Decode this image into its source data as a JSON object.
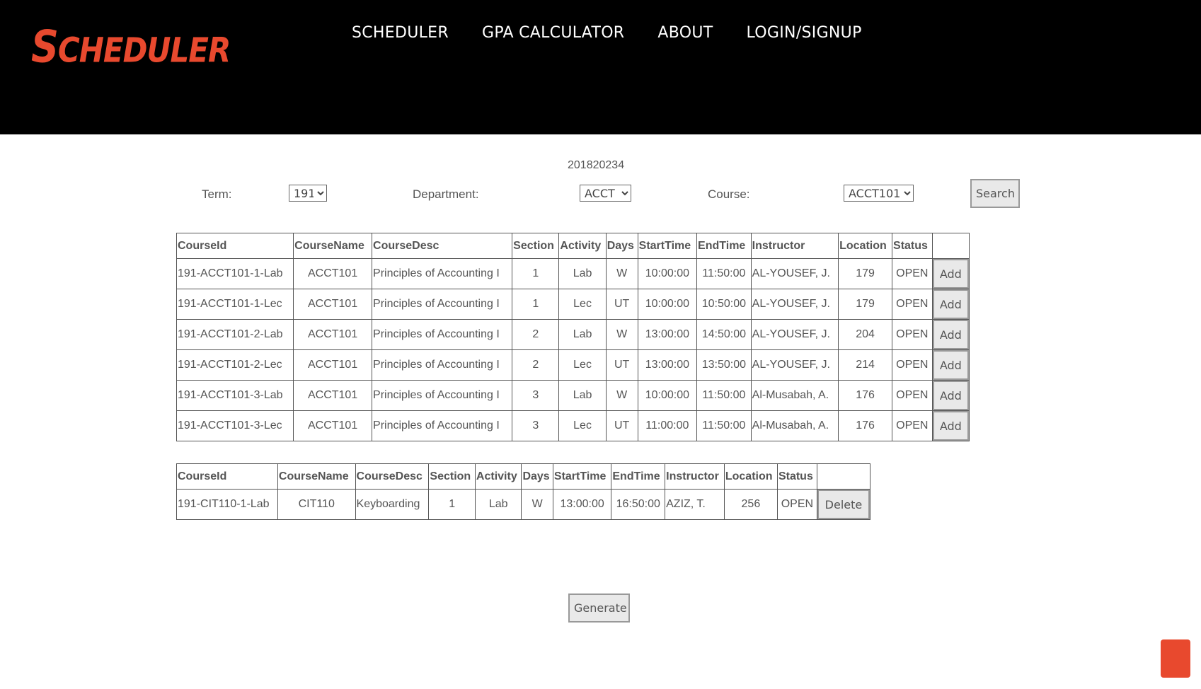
{
  "brand": {
    "logo_text": "Scheduler"
  },
  "nav": {
    "items": [
      {
        "label": "SCHEDULER"
      },
      {
        "label": "GPA CALCULATOR"
      },
      {
        "label": "ABOUT"
      },
      {
        "label": "LOGIN/SIGNUP"
      }
    ]
  },
  "student_id": "201820234",
  "filters": {
    "term_label": "Term:",
    "term_value": "191",
    "department_label": "Department:",
    "department_value": "ACCT",
    "course_label": "Course:",
    "course_value": "ACCT101",
    "search_label": "Search"
  },
  "columns": [
    "CourseId",
    "CourseName",
    "CourseDesc",
    "Section",
    "Activity",
    "Days",
    "StartTime",
    "EndTime",
    "Instructor",
    "Location",
    "Status"
  ],
  "available": [
    {
      "id": "191-ACCT101-1-Lab",
      "name": "ACCT101",
      "desc": "Principles of Accounting I",
      "section": "1",
      "activity": "Lab",
      "days": "W",
      "start": "10:00:00",
      "end": "11:50:00",
      "instructor": "AL-YOUSEF, J.",
      "location": "179",
      "status": "OPEN",
      "action": "Add"
    },
    {
      "id": "191-ACCT101-1-Lec",
      "name": "ACCT101",
      "desc": "Principles of Accounting I",
      "section": "1",
      "activity": "Lec",
      "days": "UT",
      "start": "10:00:00",
      "end": "10:50:00",
      "instructor": "AL-YOUSEF, J.",
      "location": "179",
      "status": "OPEN",
      "action": "Add"
    },
    {
      "id": "191-ACCT101-2-Lab",
      "name": "ACCT101",
      "desc": "Principles of Accounting I",
      "section": "2",
      "activity": "Lab",
      "days": "W",
      "start": "13:00:00",
      "end": "14:50:00",
      "instructor": "AL-YOUSEF, J.",
      "location": "204",
      "status": "OPEN",
      "action": "Add"
    },
    {
      "id": "191-ACCT101-2-Lec",
      "name": "ACCT101",
      "desc": "Principles of Accounting I",
      "section": "2",
      "activity": "Lec",
      "days": "UT",
      "start": "13:00:00",
      "end": "13:50:00",
      "instructor": "AL-YOUSEF, J.",
      "location": "214",
      "status": "OPEN",
      "action": "Add"
    },
    {
      "id": "191-ACCT101-3-Lab",
      "name": "ACCT101",
      "desc": "Principles of Accounting I",
      "section": "3",
      "activity": "Lab",
      "days": "W",
      "start": "10:00:00",
      "end": "11:50:00",
      "instructor": "Al-Musabah, A.",
      "location": "176",
      "status": "OPEN",
      "action": "Add"
    },
    {
      "id": "191-ACCT101-3-Lec",
      "name": "ACCT101",
      "desc": "Principles of Accounting I",
      "section": "3",
      "activity": "Lec",
      "days": "UT",
      "start": "11:00:00",
      "end": "11:50:00",
      "instructor": "Al-Musabah, A.",
      "location": "176",
      "status": "OPEN",
      "action": "Add"
    }
  ],
  "selected": [
    {
      "id": "191-CIT110-1-Lab",
      "name": "CIT110",
      "desc": "Keyboarding",
      "section": "1",
      "activity": "Lab",
      "days": "W",
      "start": "13:00:00",
      "end": "16:50:00",
      "instructor": "AZIZ, T.",
      "location": "256",
      "status": "OPEN",
      "action": "Delete"
    }
  ],
  "generate_label": "Generate",
  "colors": {
    "header_bg": "#000000",
    "brand": "#e8492e"
  }
}
